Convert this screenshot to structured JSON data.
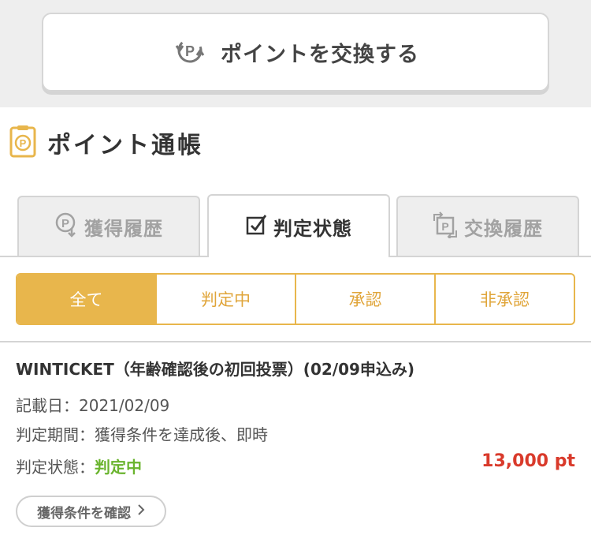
{
  "exchange_button": {
    "label": "ポイントを交換する",
    "icon": "point-exchange-icon"
  },
  "section": {
    "title": "ポイント通帳",
    "icon": "passbook-icon"
  },
  "tabs": [
    {
      "label": "獲得履歴",
      "icon": "point-earn-icon",
      "active": false
    },
    {
      "label": "判定状態",
      "icon": "checkbox-icon",
      "active": true
    },
    {
      "label": "交換履歴",
      "icon": "point-exchange-icon",
      "active": false
    }
  ],
  "filters": [
    {
      "label": "全て",
      "selected": true
    },
    {
      "label": "判定中",
      "selected": false
    },
    {
      "label": "承認",
      "selected": false
    },
    {
      "label": "非承認",
      "selected": false
    }
  ],
  "entry": {
    "title": "WINTICKET（年齢確認後の初回投票）(02/09申込み)",
    "date_label": "記載日：",
    "date": "2021/02/09",
    "period_label": "判定期間：",
    "period": "獲得条件を達成後、即時",
    "status_label": "判定状態：",
    "status": "判定中",
    "points": "13,000 pt",
    "condition_button": "獲得条件を確認",
    "condition_icon": "chevron-right-icon"
  },
  "colors": {
    "accent": "#e8b64c",
    "status_pending": "#6ab42e",
    "points": "#d93a2b",
    "band": "#eeeeee"
  }
}
